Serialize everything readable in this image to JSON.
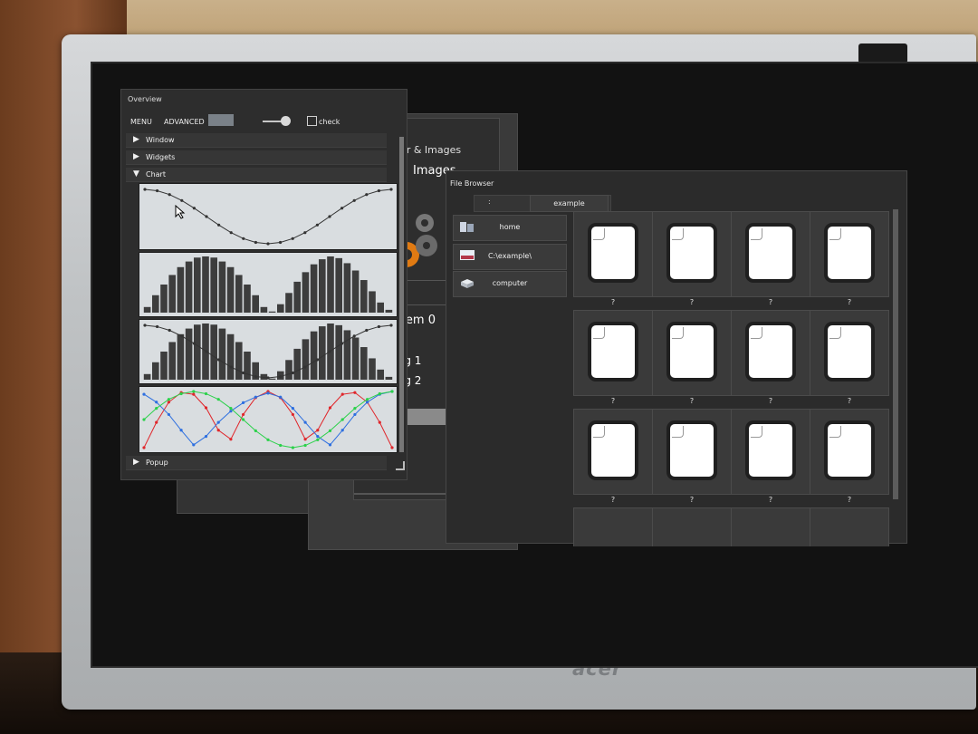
{
  "monitor": {
    "brand": "acer"
  },
  "overview": {
    "title": "Overview",
    "menu_label": "MENU",
    "advanced_label": "ADVANCED",
    "check_label": "check",
    "swatch_color": "#7a8188",
    "tree": {
      "window": "Window",
      "widgets": "Widgets",
      "chart": "Chart",
      "popup": "Popup"
    }
  },
  "scrollbar_window": {
    "title": "llbar & Images",
    "images_header": "Images",
    "row_value": "0",
    "item_label": "Item 0",
    "tag1": "ag 1",
    "tag2": "ag 2",
    "accent": "#e07a12"
  },
  "file_browser": {
    "title": "File Browser",
    "crumb_separator": ":",
    "crumb_path": "example",
    "sidebar": [
      {
        "label": "home",
        "icon": "home-folder-icon"
      },
      {
        "label": "C:\\example\\",
        "icon": "desktop-icon"
      },
      {
        "label": "computer",
        "icon": "drive-icon"
      }
    ],
    "file_captions": [
      "?",
      "?",
      "?",
      "?",
      "?",
      "?",
      "?",
      "?",
      "?",
      "?",
      "?",
      "?"
    ]
  },
  "chart_data": [
    {
      "type": "line",
      "x": [
        0,
        0.5,
        1,
        1.5,
        2,
        2.5,
        3,
        3.5,
        4,
        4.5,
        5,
        5.5,
        6,
        6.5,
        7,
        7.5,
        8,
        8.5,
        9,
        9.5,
        10
      ],
      "series": [
        {
          "values": [
            1.0,
            0.95,
            0.81,
            0.59,
            0.31,
            0.0,
            -0.31,
            -0.59,
            -0.81,
            -0.95,
            -1.0,
            -0.95,
            -0.81,
            -0.59,
            -0.31,
            0.0,
            0.31,
            0.59,
            0.81,
            0.95,
            1.0
          ]
        }
      ],
      "ylim": [
        -1,
        1
      ]
    },
    {
      "type": "bar",
      "values": [
        0.1,
        0.31,
        0.5,
        0.67,
        0.81,
        0.91,
        0.98,
        1.0,
        0.98,
        0.91,
        0.81,
        0.67,
        0.5,
        0.31,
        0.1,
        0.02,
        0.15,
        0.35,
        0.55,
        0.72,
        0.86,
        0.95,
        1.0,
        0.97,
        0.88,
        0.75,
        0.58,
        0.38,
        0.18,
        0.05
      ],
      "ylim": [
        0,
        1
      ]
    },
    {
      "type": "bar",
      "values": [
        0.1,
        0.31,
        0.5,
        0.67,
        0.81,
        0.91,
        0.98,
        1.0,
        0.98,
        0.91,
        0.81,
        0.67,
        0.5,
        0.31,
        0.1,
        0.02,
        0.15,
        0.35,
        0.55,
        0.72,
        0.86,
        0.95,
        1.0,
        0.97,
        0.88,
        0.75,
        0.58,
        0.38,
        0.18,
        0.05
      ],
      "series": [
        {
          "values": [
            1.0,
            0.95,
            0.81,
            0.59,
            0.31,
            0.0,
            -0.31,
            -0.59,
            -0.81,
            -0.95,
            -1.0,
            -0.95,
            -0.81,
            -0.59,
            -0.31,
            0.0,
            0.31,
            0.59,
            0.81,
            0.95,
            1.0
          ]
        }
      ],
      "ylim": [
        0,
        1
      ]
    },
    {
      "type": "line",
      "x": [
        0,
        0.5,
        1,
        1.5,
        2,
        2.5,
        3,
        3.5,
        4,
        4.5,
        5,
        5.5,
        6,
        6.5,
        7,
        7.5,
        8,
        8.5,
        9,
        9.5,
        10
      ],
      "series": [
        {
          "color": "#e0262b",
          "values": [
            0.0,
            0.45,
            0.81,
            0.98,
            0.95,
            0.71,
            0.31,
            0.15,
            0.59,
            0.89,
            1.0,
            0.89,
            0.59,
            0.15,
            0.31,
            0.71,
            0.95,
            0.98,
            0.81,
            0.45,
            0.0
          ]
        },
        {
          "color": "#2d6fe0",
          "values": [
            0.95,
            0.81,
            0.59,
            0.31,
            0.05,
            0.2,
            0.45,
            0.65,
            0.8,
            0.9,
            0.97,
            0.9,
            0.7,
            0.45,
            0.2,
            0.05,
            0.31,
            0.59,
            0.81,
            0.95,
            1.0
          ]
        },
        {
          "color": "#2bd14a",
          "values": [
            0.5,
            0.7,
            0.86,
            0.96,
            1.0,
            0.96,
            0.86,
            0.7,
            0.5,
            0.3,
            0.14,
            0.04,
            0.0,
            0.04,
            0.14,
            0.3,
            0.5,
            0.7,
            0.86,
            0.96,
            1.0
          ]
        }
      ],
      "ylim": [
        0,
        1
      ]
    }
  ]
}
